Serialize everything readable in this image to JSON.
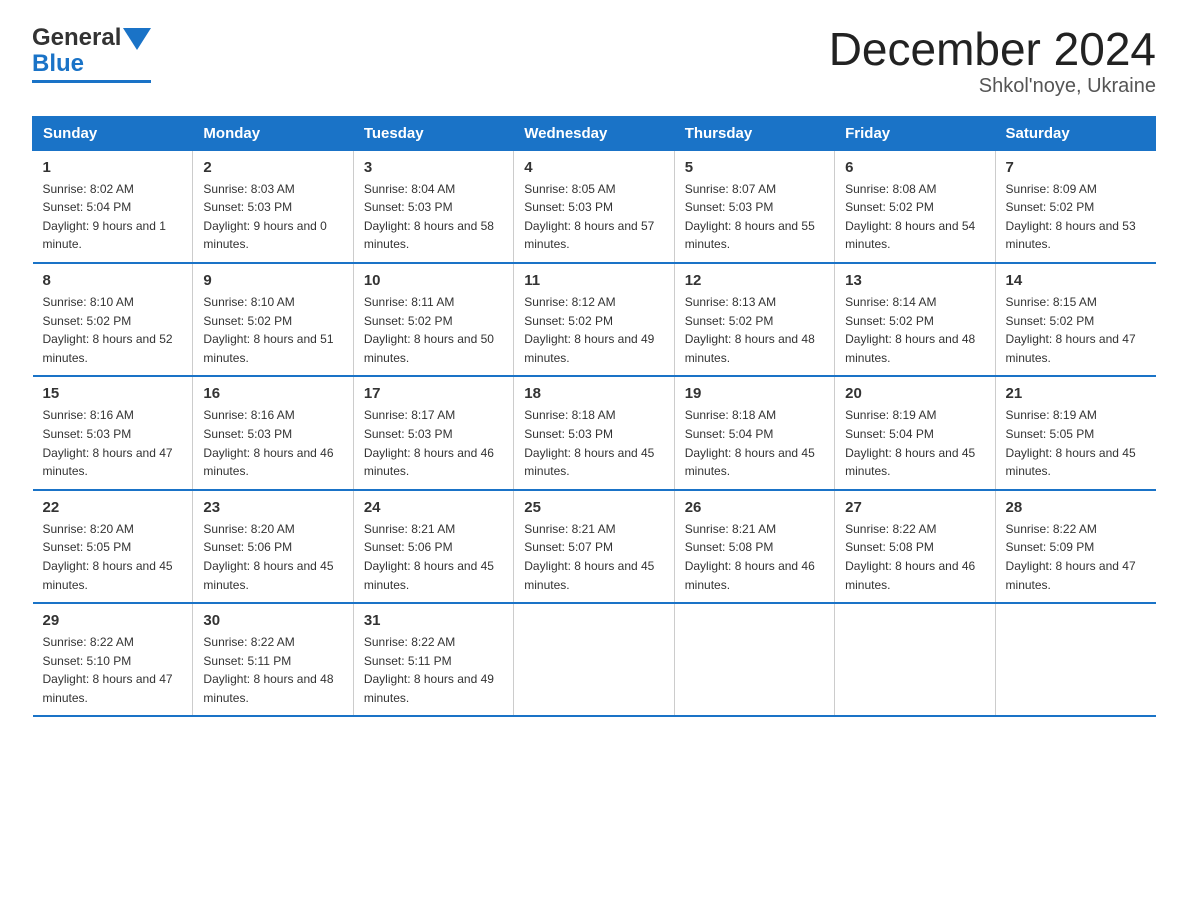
{
  "logo": {
    "general": "General",
    "blue": "Blue",
    "arrow": "▶"
  },
  "header": {
    "month_title": "December 2024",
    "location": "Shkol'noye, Ukraine"
  },
  "days_of_week": [
    "Sunday",
    "Monday",
    "Tuesday",
    "Wednesday",
    "Thursday",
    "Friday",
    "Saturday"
  ],
  "weeks": [
    [
      {
        "day": "1",
        "sunrise": "Sunrise: 8:02 AM",
        "sunset": "Sunset: 5:04 PM",
        "daylight": "Daylight: 9 hours and 1 minute."
      },
      {
        "day": "2",
        "sunrise": "Sunrise: 8:03 AM",
        "sunset": "Sunset: 5:03 PM",
        "daylight": "Daylight: 9 hours and 0 minutes."
      },
      {
        "day": "3",
        "sunrise": "Sunrise: 8:04 AM",
        "sunset": "Sunset: 5:03 PM",
        "daylight": "Daylight: 8 hours and 58 minutes."
      },
      {
        "day": "4",
        "sunrise": "Sunrise: 8:05 AM",
        "sunset": "Sunset: 5:03 PM",
        "daylight": "Daylight: 8 hours and 57 minutes."
      },
      {
        "day": "5",
        "sunrise": "Sunrise: 8:07 AM",
        "sunset": "Sunset: 5:03 PM",
        "daylight": "Daylight: 8 hours and 55 minutes."
      },
      {
        "day": "6",
        "sunrise": "Sunrise: 8:08 AM",
        "sunset": "Sunset: 5:02 PM",
        "daylight": "Daylight: 8 hours and 54 minutes."
      },
      {
        "day": "7",
        "sunrise": "Sunrise: 8:09 AM",
        "sunset": "Sunset: 5:02 PM",
        "daylight": "Daylight: 8 hours and 53 minutes."
      }
    ],
    [
      {
        "day": "8",
        "sunrise": "Sunrise: 8:10 AM",
        "sunset": "Sunset: 5:02 PM",
        "daylight": "Daylight: 8 hours and 52 minutes."
      },
      {
        "day": "9",
        "sunrise": "Sunrise: 8:10 AM",
        "sunset": "Sunset: 5:02 PM",
        "daylight": "Daylight: 8 hours and 51 minutes."
      },
      {
        "day": "10",
        "sunrise": "Sunrise: 8:11 AM",
        "sunset": "Sunset: 5:02 PM",
        "daylight": "Daylight: 8 hours and 50 minutes."
      },
      {
        "day": "11",
        "sunrise": "Sunrise: 8:12 AM",
        "sunset": "Sunset: 5:02 PM",
        "daylight": "Daylight: 8 hours and 49 minutes."
      },
      {
        "day": "12",
        "sunrise": "Sunrise: 8:13 AM",
        "sunset": "Sunset: 5:02 PM",
        "daylight": "Daylight: 8 hours and 48 minutes."
      },
      {
        "day": "13",
        "sunrise": "Sunrise: 8:14 AM",
        "sunset": "Sunset: 5:02 PM",
        "daylight": "Daylight: 8 hours and 48 minutes."
      },
      {
        "day": "14",
        "sunrise": "Sunrise: 8:15 AM",
        "sunset": "Sunset: 5:02 PM",
        "daylight": "Daylight: 8 hours and 47 minutes."
      }
    ],
    [
      {
        "day": "15",
        "sunrise": "Sunrise: 8:16 AM",
        "sunset": "Sunset: 5:03 PM",
        "daylight": "Daylight: 8 hours and 47 minutes."
      },
      {
        "day": "16",
        "sunrise": "Sunrise: 8:16 AM",
        "sunset": "Sunset: 5:03 PM",
        "daylight": "Daylight: 8 hours and 46 minutes."
      },
      {
        "day": "17",
        "sunrise": "Sunrise: 8:17 AM",
        "sunset": "Sunset: 5:03 PM",
        "daylight": "Daylight: 8 hours and 46 minutes."
      },
      {
        "day": "18",
        "sunrise": "Sunrise: 8:18 AM",
        "sunset": "Sunset: 5:03 PM",
        "daylight": "Daylight: 8 hours and 45 minutes."
      },
      {
        "day": "19",
        "sunrise": "Sunrise: 8:18 AM",
        "sunset": "Sunset: 5:04 PM",
        "daylight": "Daylight: 8 hours and 45 minutes."
      },
      {
        "day": "20",
        "sunrise": "Sunrise: 8:19 AM",
        "sunset": "Sunset: 5:04 PM",
        "daylight": "Daylight: 8 hours and 45 minutes."
      },
      {
        "day": "21",
        "sunrise": "Sunrise: 8:19 AM",
        "sunset": "Sunset: 5:05 PM",
        "daylight": "Daylight: 8 hours and 45 minutes."
      }
    ],
    [
      {
        "day": "22",
        "sunrise": "Sunrise: 8:20 AM",
        "sunset": "Sunset: 5:05 PM",
        "daylight": "Daylight: 8 hours and 45 minutes."
      },
      {
        "day": "23",
        "sunrise": "Sunrise: 8:20 AM",
        "sunset": "Sunset: 5:06 PM",
        "daylight": "Daylight: 8 hours and 45 minutes."
      },
      {
        "day": "24",
        "sunrise": "Sunrise: 8:21 AM",
        "sunset": "Sunset: 5:06 PM",
        "daylight": "Daylight: 8 hours and 45 minutes."
      },
      {
        "day": "25",
        "sunrise": "Sunrise: 8:21 AM",
        "sunset": "Sunset: 5:07 PM",
        "daylight": "Daylight: 8 hours and 45 minutes."
      },
      {
        "day": "26",
        "sunrise": "Sunrise: 8:21 AM",
        "sunset": "Sunset: 5:08 PM",
        "daylight": "Daylight: 8 hours and 46 minutes."
      },
      {
        "day": "27",
        "sunrise": "Sunrise: 8:22 AM",
        "sunset": "Sunset: 5:08 PM",
        "daylight": "Daylight: 8 hours and 46 minutes."
      },
      {
        "day": "28",
        "sunrise": "Sunrise: 8:22 AM",
        "sunset": "Sunset: 5:09 PM",
        "daylight": "Daylight: 8 hours and 47 minutes."
      }
    ],
    [
      {
        "day": "29",
        "sunrise": "Sunrise: 8:22 AM",
        "sunset": "Sunset: 5:10 PM",
        "daylight": "Daylight: 8 hours and 47 minutes."
      },
      {
        "day": "30",
        "sunrise": "Sunrise: 8:22 AM",
        "sunset": "Sunset: 5:11 PM",
        "daylight": "Daylight: 8 hours and 48 minutes."
      },
      {
        "day": "31",
        "sunrise": "Sunrise: 8:22 AM",
        "sunset": "Sunset: 5:11 PM",
        "daylight": "Daylight: 8 hours and 49 minutes."
      },
      null,
      null,
      null,
      null
    ]
  ]
}
